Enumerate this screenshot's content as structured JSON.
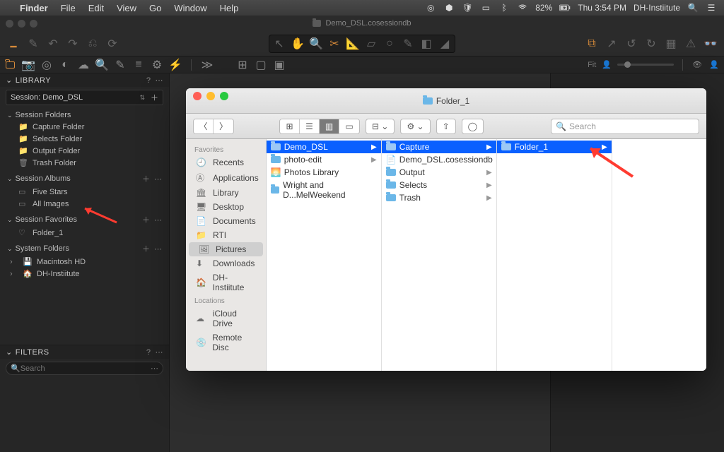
{
  "menubar": {
    "app": "Finder",
    "items": [
      "File",
      "Edit",
      "View",
      "Go",
      "Window",
      "Help"
    ],
    "battery": "82%",
    "time": "Thu 3:54 PM",
    "user": "DH-Instiitute"
  },
  "capture_one": {
    "title_icon": "folder",
    "title": "Demo_DSL.cosessiondb",
    "fit_label": "Fit",
    "library": {
      "header": "LIBRARY",
      "session_label": "Session: Demo_DSL",
      "groups": [
        {
          "name": "Session Folders",
          "items": [
            "Capture Folder",
            "Selects Folder",
            "Output Folder",
            "Trash Folder"
          ]
        },
        {
          "name": "Session Albums",
          "items": [
            "Five Stars",
            "All Images"
          ]
        },
        {
          "name": "Session Favorites",
          "items": [
            "Folder_1"
          ]
        },
        {
          "name": "System Folders",
          "items": [
            "Macintosh HD",
            "DH-Instiitute"
          ]
        }
      ]
    },
    "filters": {
      "header": "FILTERS",
      "search_placeholder": "Search"
    }
  },
  "finder": {
    "title": "Folder_1",
    "search_placeholder": "Search",
    "sidebar": {
      "favorites_label": "Favorites",
      "favorites": [
        "Recents",
        "Applications",
        "Library",
        "Desktop",
        "Documents",
        "RTI",
        "Pictures",
        "Downloads",
        "DH-Instiitute"
      ],
      "selected_favorite": "Pictures",
      "locations_label": "Locations",
      "locations": [
        "iCloud Drive",
        "Remote Disc"
      ]
    },
    "columns": [
      {
        "items": [
          {
            "name": "Demo_DSL",
            "icon": "folder",
            "has_children": true
          },
          {
            "name": "photo-edit",
            "icon": "folder",
            "has_children": true
          },
          {
            "name": "Photos Library",
            "icon": "photoslib",
            "has_children": false
          },
          {
            "name": "Wright and D...MelWeekend",
            "icon": "folder",
            "has_children": false
          }
        ],
        "selected": 0
      },
      {
        "items": [
          {
            "name": "Capture",
            "icon": "folder",
            "has_children": true
          },
          {
            "name": "Demo_DSL.cosessiondb",
            "icon": "codoc",
            "has_children": false
          },
          {
            "name": "Output",
            "icon": "folder",
            "has_children": true
          },
          {
            "name": "Selects",
            "icon": "folder",
            "has_children": true
          },
          {
            "name": "Trash",
            "icon": "folder",
            "has_children": true
          }
        ],
        "selected": 0
      },
      {
        "items": [
          {
            "name": "Folder_1",
            "icon": "folder",
            "has_children": true
          }
        ],
        "selected": 0
      }
    ]
  }
}
